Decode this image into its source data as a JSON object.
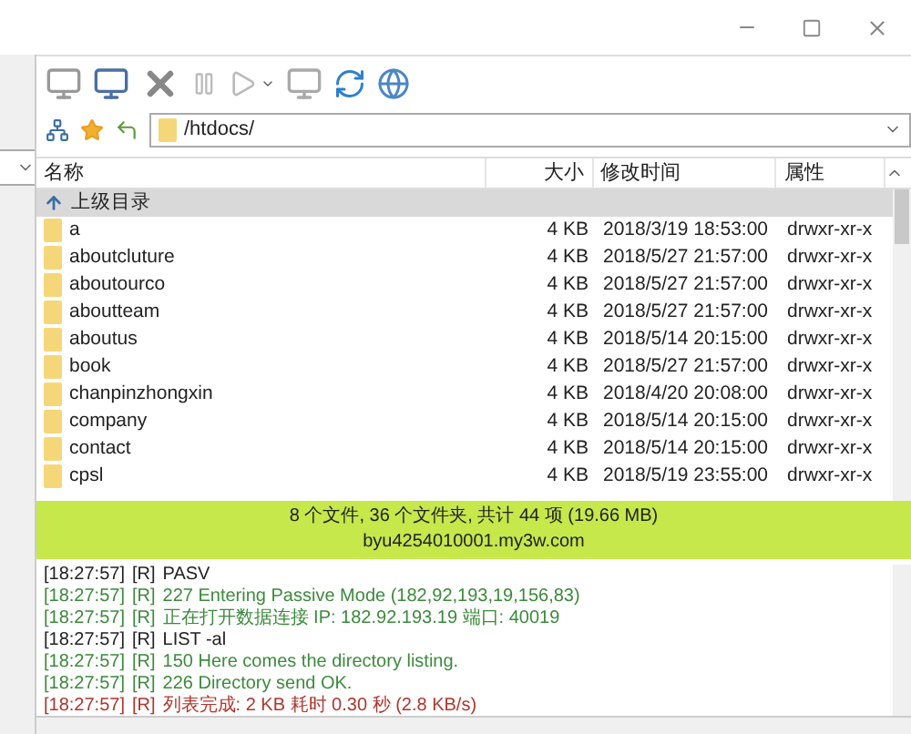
{
  "address": {
    "value": "/htdocs/"
  },
  "table": {
    "columns": [
      {
        "label": "名称"
      },
      {
        "label": "大小"
      },
      {
        "label": "修改时间"
      },
      {
        "label": "属性"
      }
    ],
    "parent_row": {
      "label": "上级目录",
      "selected": true
    },
    "rows": [
      {
        "name": "a",
        "size": "4 KB",
        "modified": "2018/3/19 18:53:00",
        "attributes": "drwxr-xr-x"
      },
      {
        "name": "aboutcluture",
        "size": "4 KB",
        "modified": "2018/5/27 21:57:00",
        "attributes": "drwxr-xr-x"
      },
      {
        "name": "aboutourco",
        "size": "4 KB",
        "modified": "2018/5/27 21:57:00",
        "attributes": "drwxr-xr-x"
      },
      {
        "name": "aboutteam",
        "size": "4 KB",
        "modified": "2018/5/27 21:57:00",
        "attributes": "drwxr-xr-x"
      },
      {
        "name": "aboutus",
        "size": "4 KB",
        "modified": "2018/5/14 20:15:00",
        "attributes": "drwxr-xr-x"
      },
      {
        "name": "book",
        "size": "4 KB",
        "modified": "2018/5/27 21:57:00",
        "attributes": "drwxr-xr-x"
      },
      {
        "name": "chanpinzhongxin",
        "size": "4 KB",
        "modified": "2018/4/20 20:08:00",
        "attributes": "drwxr-xr-x"
      },
      {
        "name": "company",
        "size": "4 KB",
        "modified": "2018/5/14 20:15:00",
        "attributes": "drwxr-xr-x"
      },
      {
        "name": "contact",
        "size": "4 KB",
        "modified": "2018/5/14 20:15:00",
        "attributes": "drwxr-xr-x"
      },
      {
        "name": "cpsl",
        "size": "4 KB",
        "modified": "2018/5/19 23:55:00",
        "attributes": "drwxr-xr-x"
      }
    ]
  },
  "status": {
    "summary": "8 个文件, 36 个文件夹, 共计 44 项 (19.66 MB)",
    "host": "byu4254010001.my3w.com"
  },
  "log": [
    {
      "time": "[18:27:57]",
      "source": "[R]",
      "message": "PASV",
      "kind": "command"
    },
    {
      "time": "[18:27:57]",
      "source": "[R]",
      "message": "227 Entering Passive Mode (182,92,193,19,156,83)",
      "kind": "response"
    },
    {
      "time": "[18:27:57]",
      "source": "[R]",
      "message": "正在打开数据连接 IP: 182.92.193.19 端口: 40019",
      "kind": "response"
    },
    {
      "time": "[18:27:57]",
      "source": "[R]",
      "message": "LIST -al",
      "kind": "command"
    },
    {
      "time": "[18:27:57]",
      "source": "[R]",
      "message": "150 Here comes the directory listing.",
      "kind": "response"
    },
    {
      "time": "[18:27:57]",
      "source": "[R]",
      "message": "226 Directory send OK.",
      "kind": "response"
    },
    {
      "time": "[18:27:57]",
      "source": "[R]",
      "message": "列表完成: 2 KB 耗时 0.30 秒 (2.8 KB/s)",
      "kind": "complete"
    }
  ]
}
